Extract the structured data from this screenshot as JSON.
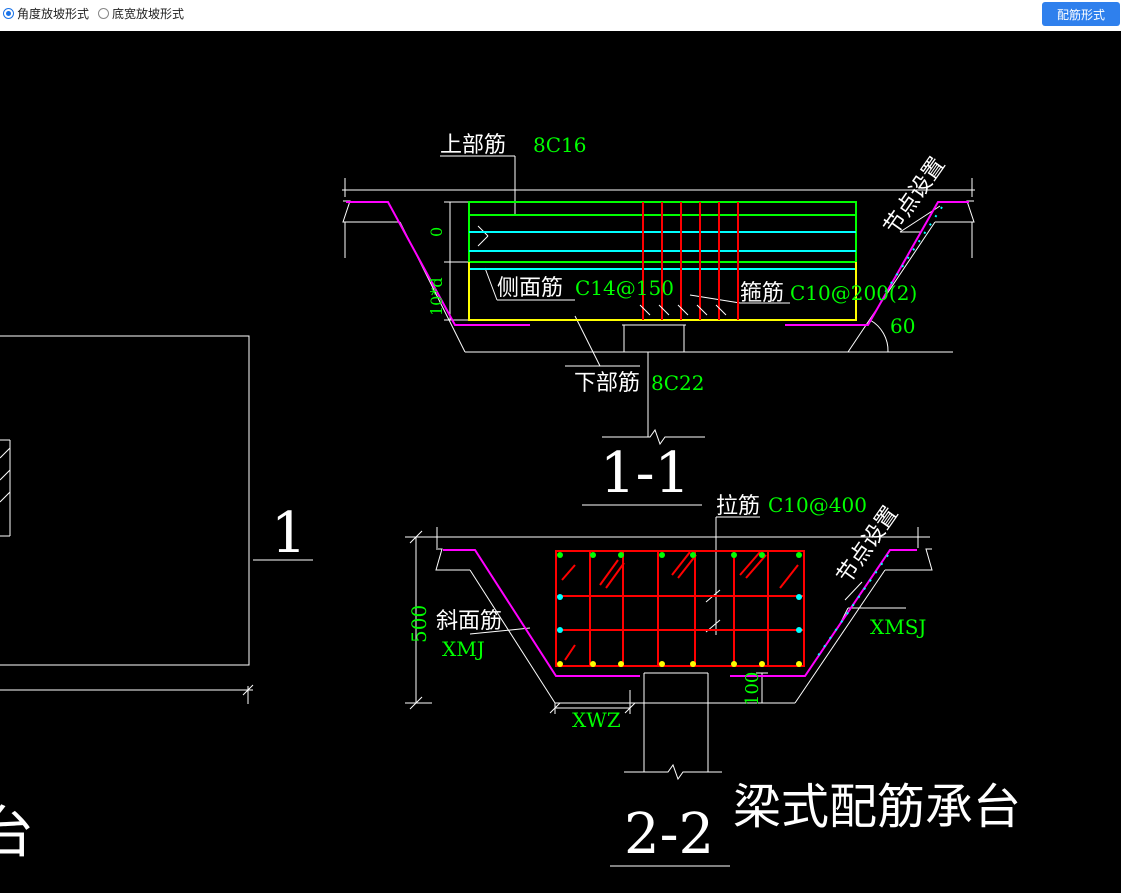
{
  "toolbar": {
    "options": [
      {
        "label": "角度放坡形式",
        "selected": true
      },
      {
        "label": "底宽放坡形式",
        "selected": false
      }
    ],
    "button_label": "配筋形式"
  },
  "drawing": {
    "section1": {
      "title": "1-1",
      "top_bar_label": "上部筋",
      "top_bar_value": "8C16",
      "side_bar_label": "侧面筋",
      "side_bar_value": "C14@150",
      "stirrup_label": "箍筋",
      "stirrup_value": "C10@200(2)",
      "bottom_bar_label": "下部筋",
      "bottom_bar_value": "8C22",
      "node_setting": "节点设置",
      "angle_value": "60",
      "dim_zero": "0",
      "dim_10d": "10*d"
    },
    "section2": {
      "title": "2-2",
      "tie_bar_label": "拉筋",
      "tie_bar_value": "C10@400",
      "slope_bar_label": "斜面筋",
      "slope_bar_code": "XMJ",
      "node_setting": "节点设置",
      "xmsj": "XMSJ",
      "xwz": "XWZ",
      "dim_500": "500",
      "dim_100": "100"
    },
    "plan": {
      "section_mark": "1",
      "partial_char": "台"
    },
    "main_title": "梁式配筋承台"
  },
  "colors": {
    "background": "#000000",
    "line": "#ffffff",
    "rebar": "#ff0000",
    "green": "#00ff00",
    "cyan": "#00ffff",
    "magenta": "#ff00ff",
    "yellow": "#ffff00",
    "button": "#2f80ed"
  }
}
